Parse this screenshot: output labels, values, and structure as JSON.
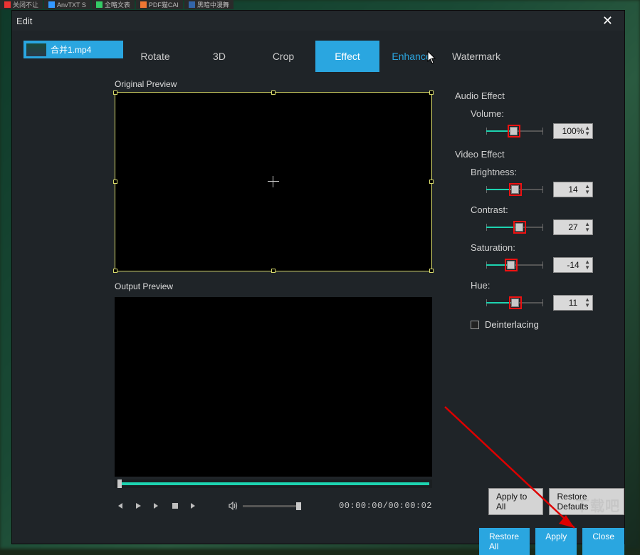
{
  "browser_tabs": [
    "关闭不让",
    "AnvTXT S",
    "全略文表",
    "PDF猫CAI",
    "黑暗中漫舞"
  ],
  "dialog_title": "Edit",
  "file_name": "合并1.mp4",
  "tabs": {
    "rotate": "Rotate",
    "three_d": "3D",
    "crop": "Crop",
    "effect": "Effect",
    "enhance": "Enhance",
    "watermark": "Watermark"
  },
  "labels": {
    "original_preview": "Original Preview",
    "output_preview": "Output Preview",
    "audio_effect": "Audio Effect",
    "volume": "Volume:",
    "video_effect": "Video Effect",
    "brightness": "Brightness:",
    "contrast": "Contrast:",
    "saturation": "Saturation:",
    "hue": "Hue:",
    "deinterlacing": "Deinterlacing"
  },
  "values": {
    "volume": "100%",
    "brightness": "14",
    "contrast": "27",
    "saturation": "-14",
    "hue": "11"
  },
  "slider_pos": {
    "volume": 38,
    "brightness": 40,
    "contrast": 46,
    "saturation": 34,
    "hue": 40
  },
  "time_display": "00:00:00/00:00:02",
  "buttons": {
    "apply_to_all": "Apply to All",
    "restore_defaults": "Restore Defaults",
    "restore_all": "Restore All",
    "apply": "Apply",
    "close": "Close"
  }
}
